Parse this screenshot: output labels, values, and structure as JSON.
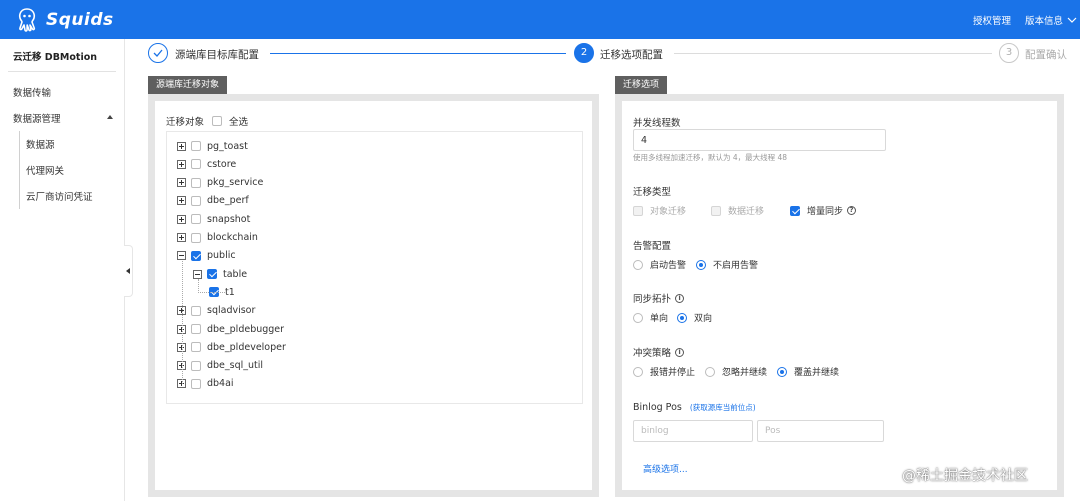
{
  "header": {
    "brand": "Squids",
    "links": [
      "授权管理",
      "版本信息"
    ],
    "accent": "#1a73e8"
  },
  "sidebar": {
    "title": "云迁移 DBMotion",
    "items": [
      "数据传输",
      "数据源管理"
    ],
    "sub_items": [
      "数据源",
      "代理网关",
      "云厂商访问凭证"
    ]
  },
  "steps": [
    {
      "number": "1",
      "label": "源端库目标库配置",
      "state": "done"
    },
    {
      "number": "2",
      "label": "迁移选项配置",
      "state": "active"
    },
    {
      "number": "3",
      "label": "配置确认",
      "state": "pending"
    }
  ],
  "left_panel": {
    "tab": "源端库迁移对象",
    "header_label": "迁移对象",
    "select_all": "全选",
    "tree": [
      {
        "label": "pg_toast",
        "level": 0,
        "expander": "plus",
        "checked": false
      },
      {
        "label": "cstore",
        "level": 0,
        "expander": "plus",
        "checked": false
      },
      {
        "label": "pkg_service",
        "level": 0,
        "expander": "plus",
        "checked": false
      },
      {
        "label": "dbe_perf",
        "level": 0,
        "expander": "plus",
        "checked": false
      },
      {
        "label": "snapshot",
        "level": 0,
        "expander": "plus",
        "checked": false
      },
      {
        "label": "blockchain",
        "level": 0,
        "expander": "plus",
        "checked": false
      },
      {
        "label": "public",
        "level": 0,
        "expander": "minus",
        "checked": true
      },
      {
        "label": "table",
        "level": 1,
        "expander": "minus",
        "checked": true
      },
      {
        "label": "t1",
        "level": 2,
        "expander": "none",
        "checked": true
      },
      {
        "label": "sqladvisor",
        "level": 0,
        "expander": "plus",
        "checked": false
      },
      {
        "label": "dbe_pldebugger",
        "level": 0,
        "expander": "plus",
        "checked": false
      },
      {
        "label": "dbe_pldeveloper",
        "level": 0,
        "expander": "plus",
        "checked": false
      },
      {
        "label": "dbe_sql_util",
        "level": 0,
        "expander": "plus",
        "checked": false
      },
      {
        "label": "db4ai",
        "level": 0,
        "expander": "plus",
        "checked": false
      }
    ]
  },
  "right_panel": {
    "tab": "迁移选项",
    "threads": {
      "label": "并发线程数",
      "value": "4",
      "hint": "使用多线程加速迁移，默认为 4，最大线程 48"
    },
    "migration_type": {
      "label": "迁移类型",
      "options": [
        {
          "label": "对象迁移",
          "checked": false,
          "disabled": true
        },
        {
          "label": "数据迁移",
          "checked": false,
          "disabled": true
        },
        {
          "label": "增量同步",
          "checked": true,
          "disabled": false
        }
      ]
    },
    "alert": {
      "label": "告警配置",
      "options": [
        {
          "label": "启动告警",
          "selected": false
        },
        {
          "label": "不启用告警",
          "selected": true
        }
      ]
    },
    "topology": {
      "label": "同步拓扑",
      "options": [
        {
          "label": "单向",
          "selected": false
        },
        {
          "label": "双向",
          "selected": true
        }
      ]
    },
    "conflict": {
      "label": "冲突策略",
      "options": [
        {
          "label": "报错并停止",
          "selected": false
        },
        {
          "label": "忽略并继续",
          "selected": false
        },
        {
          "label": "覆盖并继续",
          "selected": true
        }
      ]
    },
    "binlog": {
      "label": "Binlog Pos",
      "fetch_link": "(获取源库当前位点)",
      "binlog_placeholder": "binlog",
      "pos_placeholder": "Pos"
    },
    "advanced_link": "高级选项..."
  },
  "watermark": "@稀土掘金技术社区"
}
